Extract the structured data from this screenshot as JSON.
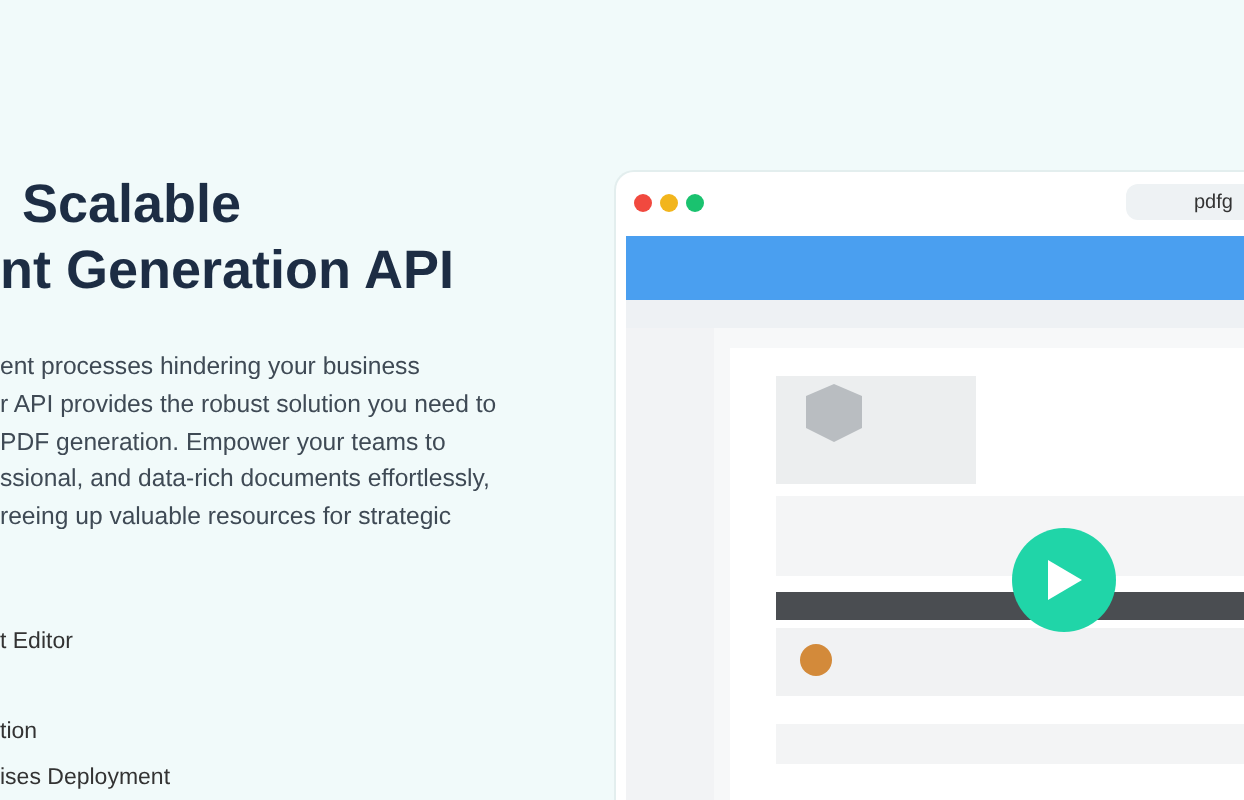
{
  "hero": {
    "heading_lines": [
      "Scalable",
      "nt Generation API"
    ],
    "paragraph_lines": [
      "ent processes hindering your business",
      "r API provides the robust solution you need to",
      "PDF generation. Empower your teams to",
      "ssional, and data-rich documents effortlessly,",
      "reeing up valuable resources for strategic"
    ],
    "features": [
      "t Editor",
      "tion",
      "ises Deployment"
    ]
  },
  "demo_window": {
    "address": "pdfg"
  }
}
